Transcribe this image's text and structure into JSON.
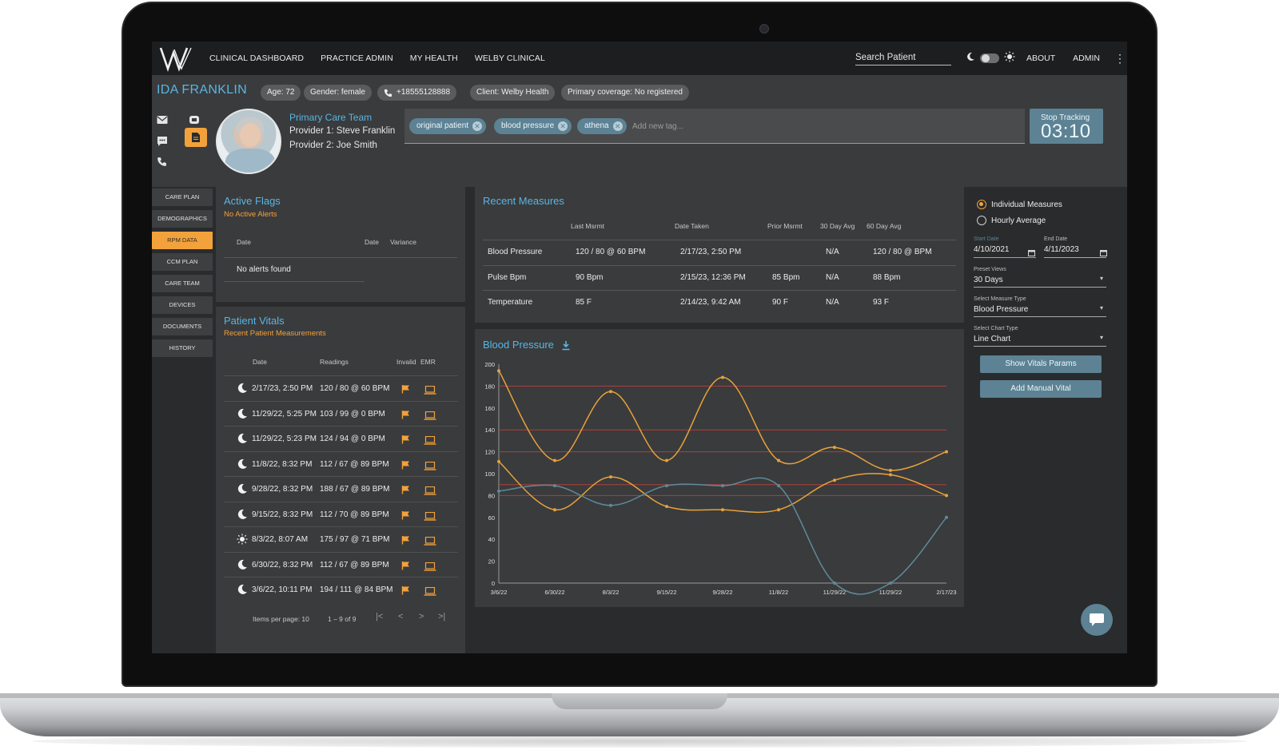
{
  "nav": {
    "items": [
      "CLINICAL DASHBOARD",
      "PRACTICE ADMIN",
      "MY HEALTH",
      "WELBY CLINICAL"
    ],
    "search_placeholder": "Search Patient",
    "about": "ABOUT",
    "admin": "ADMIN"
  },
  "patient": {
    "name": "IDA FRANKLIN",
    "age": "Age: 72",
    "gender": "Gender: female",
    "phone": "+18555128888",
    "client": "Client: Welby Health",
    "coverage": "Primary coverage: No registered",
    "care_team_title": "Primary Care Team",
    "provider1": "Provider 1: Steve Franklin",
    "provider2": "Provider 2: Joe Smith",
    "tags": [
      "original patient",
      "blood pressure",
      "athena"
    ],
    "tag_placeholder": "Add new tag...",
    "stop_tracking_label": "Stop Tracking",
    "timer": "03:10"
  },
  "left_nav": {
    "items": [
      "CARE PLAN",
      "DEMOGRAPHICS",
      "RPM DATA",
      "CCM PLAN",
      "CARE TEAM",
      "DEVICES",
      "DOCUMENTS",
      "HISTORY"
    ],
    "active_index": 2
  },
  "active_flags": {
    "title": "Active Flags",
    "subtitle": "No Active Alerts",
    "headers": [
      "Date",
      "Date",
      "Variance"
    ],
    "empty": "No alerts found"
  },
  "patient_vitals": {
    "title": "Patient Vitals",
    "subtitle": "Recent Patient Measurements",
    "headers": [
      "Date",
      "Readings",
      "Invalid",
      "EMR"
    ],
    "rows": [
      {
        "period": "night",
        "date": "2/17/23, 2:50 PM",
        "reading": "120 / 80 @ 60 BPM"
      },
      {
        "period": "night",
        "date": "11/29/22, 5:25 PM",
        "reading": "103 / 99 @ 0 BPM"
      },
      {
        "period": "night",
        "date": "11/29/22, 5:23 PM",
        "reading": "124 / 94 @ 0 BPM"
      },
      {
        "period": "night",
        "date": "11/8/22, 8:32 PM",
        "reading": "112 / 67 @ 89 BPM"
      },
      {
        "period": "night",
        "date": "9/28/22, 8:32 PM",
        "reading": "188 / 67 @ 89 BPM"
      },
      {
        "period": "night",
        "date": "9/15/22, 8:32 PM",
        "reading": "112 / 70 @ 89 BPM"
      },
      {
        "period": "day",
        "date": "8/3/22, 8:07 AM",
        "reading": "175 / 97 @ 71 BPM"
      },
      {
        "period": "night",
        "date": "6/30/22, 8:32 PM",
        "reading": "112 / 67 @ 89 BPM"
      },
      {
        "period": "night",
        "date": "3/6/22, 10:11 PM",
        "reading": "194 / 111 @ 84 BPM"
      }
    ],
    "items_per_page_label": "Items per page: 10",
    "range_label": "1 – 9 of 9"
  },
  "recent_measures": {
    "title": "Recent Measures",
    "headers": [
      "Last Msrmt",
      "Date Taken",
      "Prior Msrmt",
      "30 Day Avg",
      "60 Day Avg"
    ],
    "rows": [
      {
        "name": "Blood Pressure",
        "last": "120 / 80 @ 60 BPM",
        "date": "2/17/23, 2:50 PM",
        "prior": "",
        "avg30": "N/A",
        "avg60": "120 / 80 @ BPM"
      },
      {
        "name": "Pulse Bpm",
        "last": "90 Bpm",
        "date": "2/15/23, 12:36 PM",
        "prior": "85 Bpm",
        "avg30": "N/A",
        "avg60": "88 Bpm"
      },
      {
        "name": "Temperature",
        "last": "85 F",
        "date": "2/14/23, 9:42 AM",
        "prior": "90 F",
        "avg30": "N/A",
        "avg60": "93 F"
      }
    ]
  },
  "controls": {
    "radio_individual": "Individual Measures",
    "radio_hourly": "Hourly Average",
    "start_date_label": "Start Date",
    "start_date": "4/10/2021",
    "end_date_label": "End Date",
    "end_date": "4/11/2023",
    "preset_label": "Preset Views",
    "preset_value": "30 Days",
    "measure_type_label": "Select Measure Type",
    "measure_type_value": "Blood Pressure",
    "chart_type_label": "Select Chart Type",
    "chart_type_value": "Line Chart",
    "show_vitals_btn": "Show Vitals Params",
    "add_manual_btn": "Add Manual Vital"
  },
  "colors": {
    "accent": "#58b6e4",
    "orange": "#f3a23b",
    "teal": "#5c8294",
    "threshold": "#b0403a"
  },
  "chart_data": {
    "type": "line",
    "title": "Blood Pressure",
    "categories": [
      "3/6/22",
      "6/30/22",
      "8/3/22",
      "9/15/22",
      "9/28/22",
      "11/8/22",
      "11/29/22",
      "11/29/22",
      "2/17/23"
    ],
    "series": [
      {
        "values": [
          194,
          112,
          175,
          112,
          188,
          112,
          124,
          103,
          120
        ],
        "color": "#e8a23a"
      },
      {
        "values": [
          111,
          67,
          97,
          70,
          67,
          67,
          94,
          99,
          80
        ],
        "color": "#e8a23a"
      },
      {
        "values": [
          84,
          89,
          71,
          89,
          89,
          89,
          0,
          0,
          60
        ],
        "color": "#5f8a99"
      }
    ],
    "thresholds": [
      180,
      140,
      120,
      90,
      80
    ],
    "ylim": [
      0,
      200
    ],
    "yticks": [
      0,
      20,
      40,
      60,
      80,
      100,
      120,
      140,
      160,
      180,
      200
    ],
    "xlabel": "",
    "ylabel": "",
    "grid": false
  }
}
